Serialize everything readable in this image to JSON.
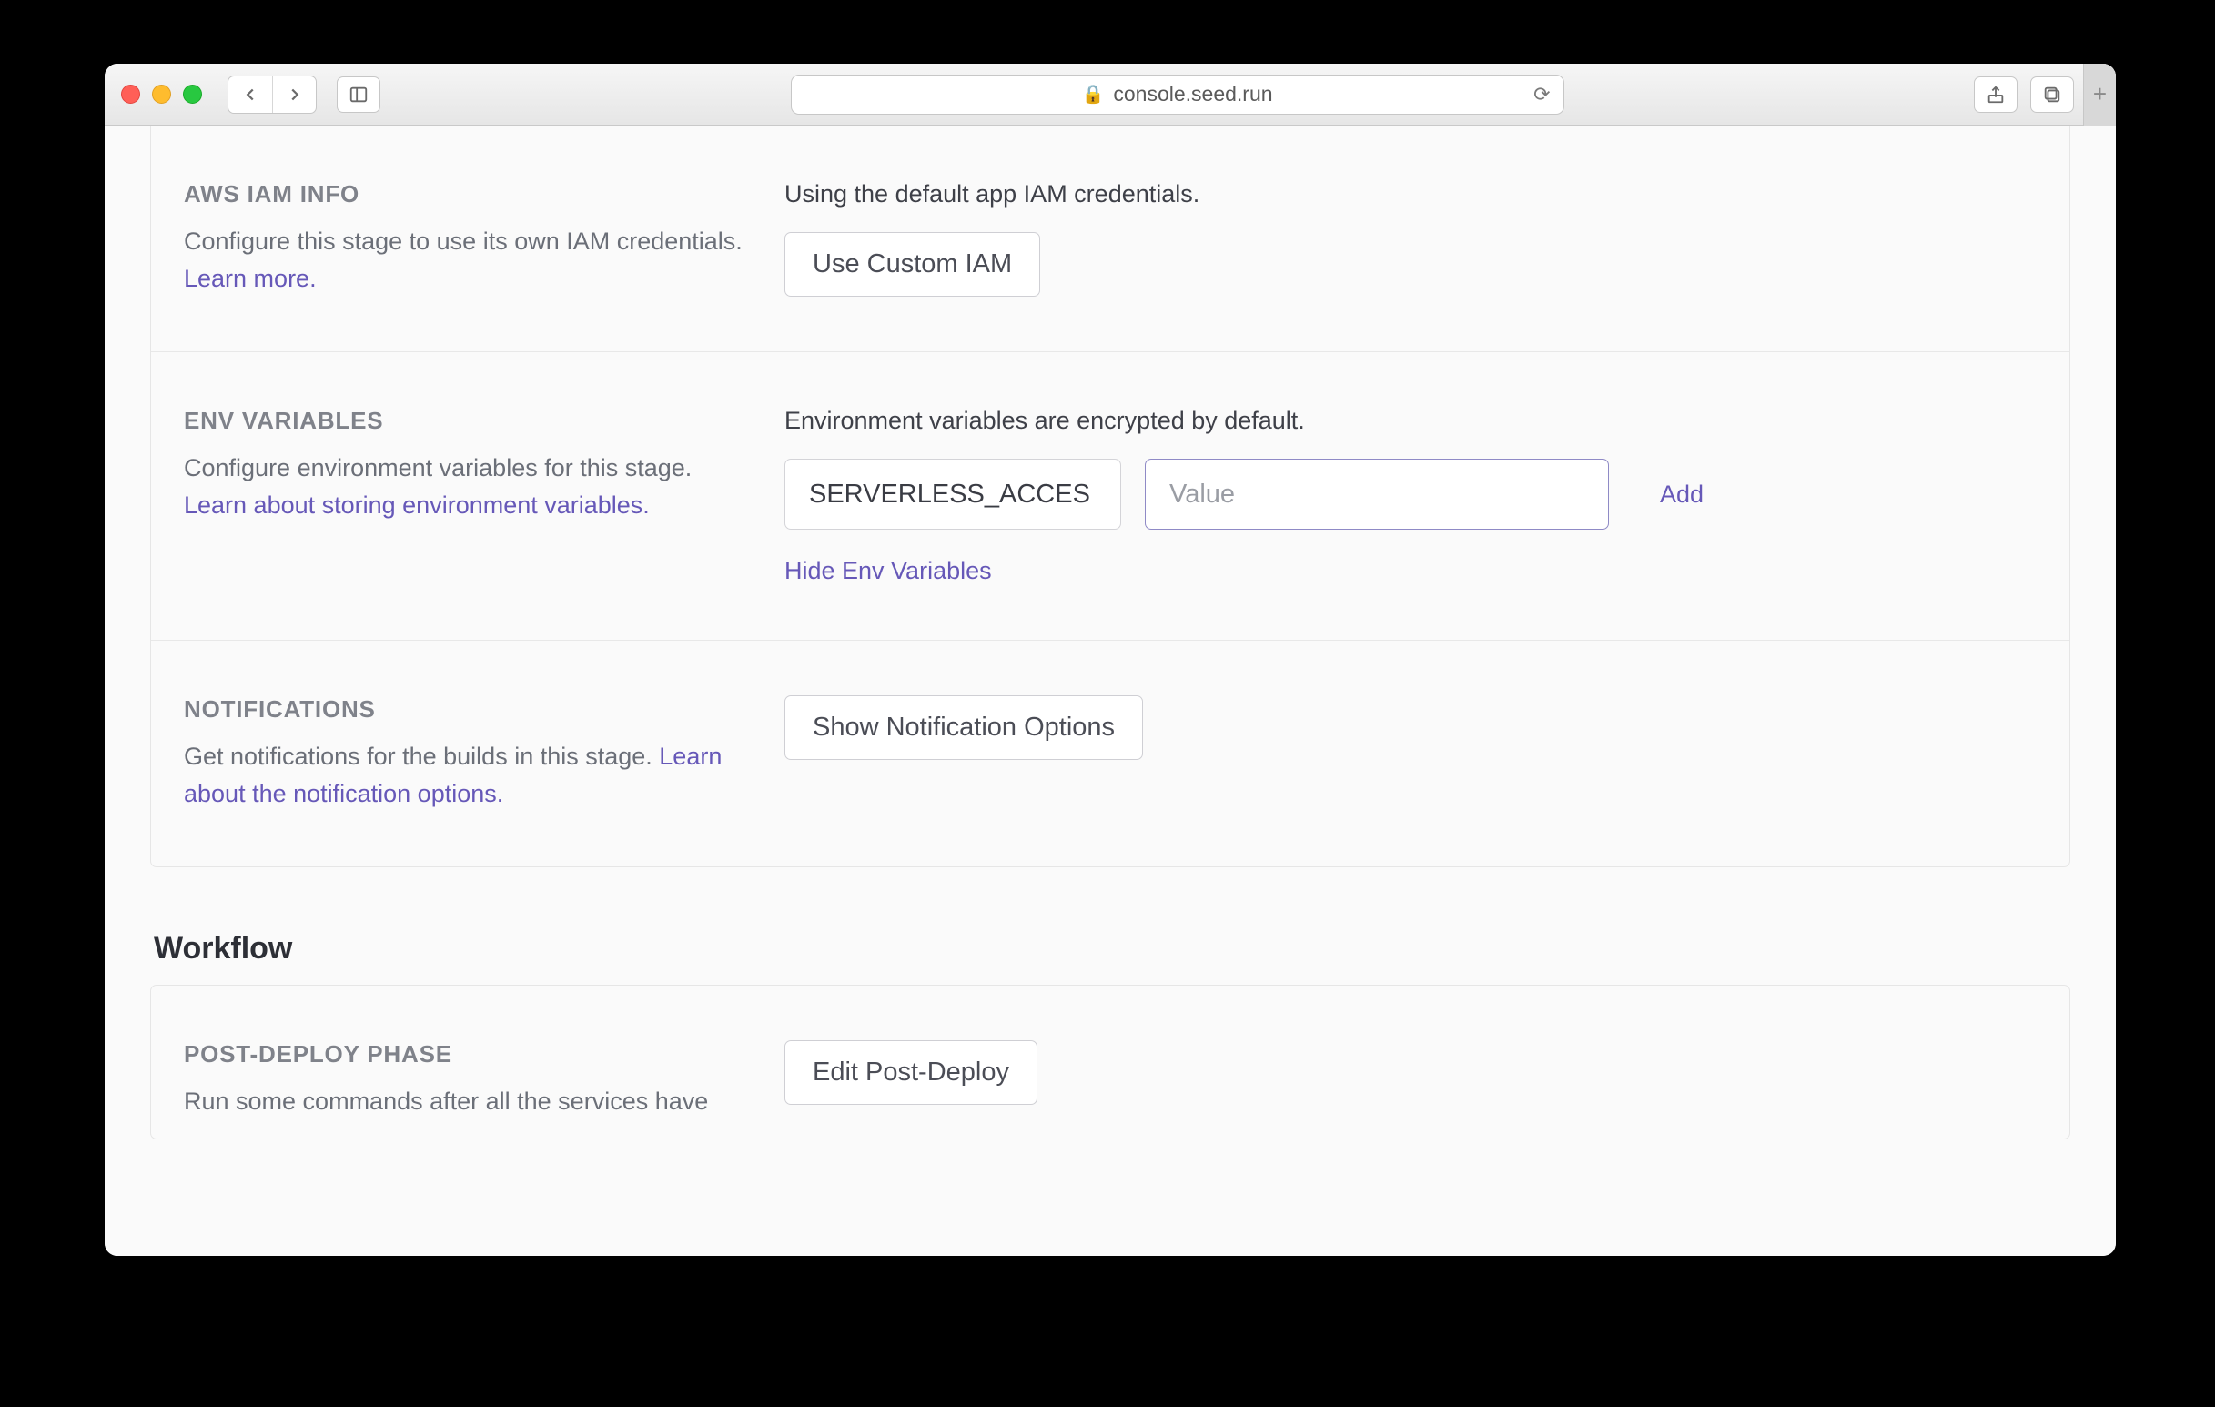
{
  "browser": {
    "url": "console.seed.run"
  },
  "sections": {
    "iam": {
      "title": "AWS IAM INFO",
      "desc_prefix": "Configure this stage to use its own IAM credentials. ",
      "learn_more": "Learn more.",
      "status": "Using the default app IAM credentials.",
      "button": "Use Custom IAM"
    },
    "env": {
      "title": "ENV VARIABLES",
      "desc_prefix": "Configure environment variables for this stage. ",
      "learn_link": "Learn about storing environment variables.",
      "status": "Environment variables are encrypted by default.",
      "key_value": "SERVERLESS_ACCES",
      "value_placeholder": "Value",
      "add": "Add",
      "hide": "Hide Env Variables"
    },
    "notifications": {
      "title": "NOTIFICATIONS",
      "desc_prefix": "Get notifications for the builds in this stage. ",
      "learn_link": "Learn about the notification options.",
      "button": "Show Notification Options"
    }
  },
  "workflow": {
    "heading": "Workflow",
    "postdeploy": {
      "title": "POST-DEPLOY PHASE",
      "desc": "Run some commands after all the services have",
      "button": "Edit Post-Deploy"
    }
  }
}
